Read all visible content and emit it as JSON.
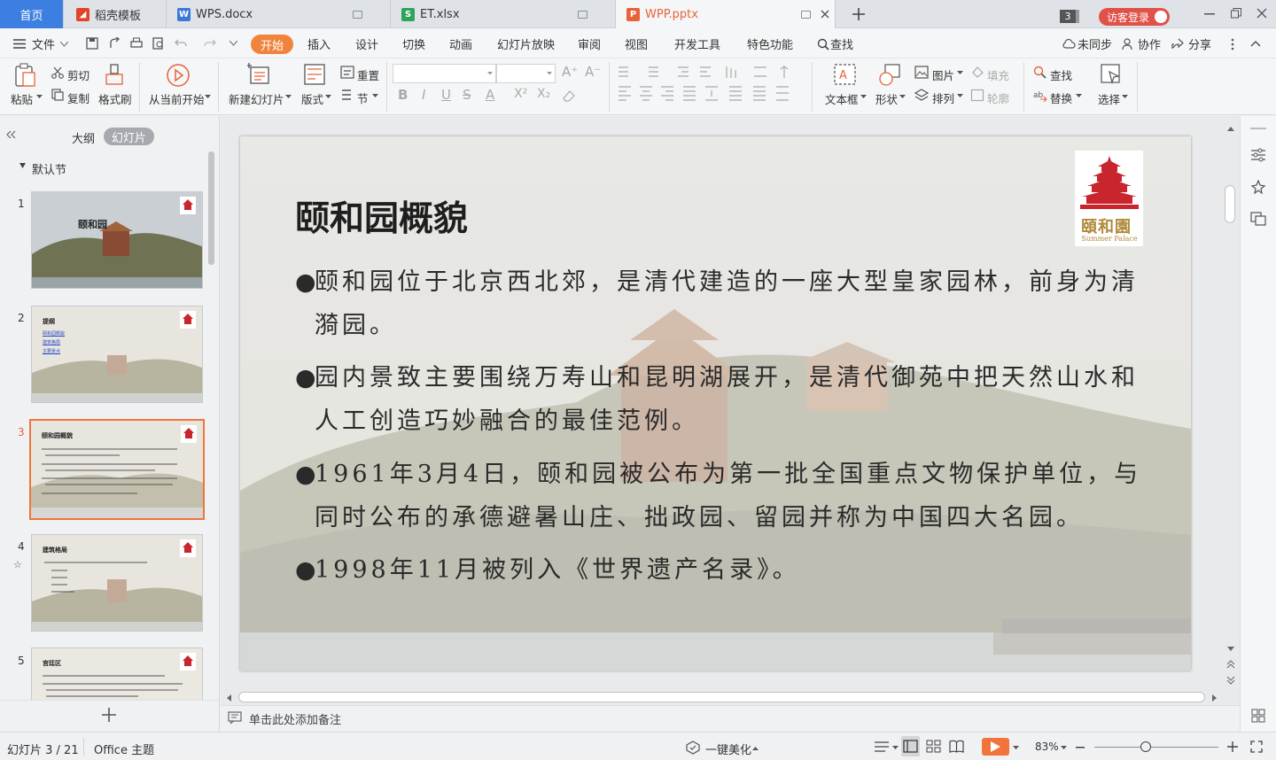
{
  "tabs": {
    "home": "首页",
    "items": [
      {
        "label": "稻壳模板",
        "icon": "daoke-icon",
        "color": "#e0452b"
      },
      {
        "label": "WPS.docx",
        "icon": "word-icon",
        "color": "#3b78d8"
      },
      {
        "label": "ET.xlsx",
        "icon": "excel-icon",
        "color": "#2fa35a"
      },
      {
        "label": "WPP.pptx",
        "icon": "ppt-icon",
        "color": "#e8623a"
      }
    ],
    "count": "3",
    "visitor_login": "访客登录"
  },
  "menu": {
    "file": "文件",
    "tabs": [
      "开始",
      "插入",
      "设计",
      "切换",
      "动画",
      "幻灯片放映",
      "审阅",
      "视图",
      "开发工具",
      "特色功能"
    ],
    "search": "查找",
    "sync": "未同步",
    "collab": "协作",
    "share": "分享"
  },
  "ribbon": {
    "paste": "粘贴",
    "cut": "剪切",
    "copy": "复制",
    "format_painter": "格式刷",
    "play_from_current": "从当前开始",
    "new_slide": "新建幻灯片",
    "layout": "版式",
    "reset": "重置",
    "section": "节",
    "text_box": "文本框",
    "shape": "形状",
    "picture": "图片",
    "fill": "填充",
    "arrange": "排列",
    "outline": "轮廓",
    "find": "查找",
    "replace": "替换",
    "select": "选择"
  },
  "left_panel": {
    "outline_tab": "大纲",
    "slides_tab": "幻灯片",
    "section": "默认节",
    "thumbnails": [
      {
        "num": "1",
        "title": "颐和园"
      },
      {
        "num": "2",
        "title": "提纲",
        "links": [
          "颐和园概貌",
          "建筑格局",
          "主要景点"
        ]
      },
      {
        "num": "3",
        "title": "颐和园概貌"
      },
      {
        "num": "4",
        "title": "建筑格局"
      },
      {
        "num": "5",
        "title": "宫廷区"
      }
    ]
  },
  "slide": {
    "title": "颐和园概貌",
    "logo_text": "頤和園",
    "logo_subtitle": "Summer Palace",
    "bullets": [
      "颐和园位于北京西北郊，是清代建造的一座大型皇家园林，前身为清漪园。",
      "园内景致主要围绕万寿山和昆明湖展开，是清代御苑中把天然山水和人工创造巧妙融合的最佳范例。",
      "1961年3月4日，颐和园被公布为第一批全国重点文物保护单位，与同时公布的承德避暑山庄、拙政园、留园并称为中国四大名园。",
      "1998年11月被列入《世界遗产名录》。"
    ]
  },
  "notes_placeholder": "单击此处添加备注",
  "status": {
    "slide_info": "幻灯片 3 / 21",
    "theme": "Office 主题",
    "beautify": "一键美化",
    "zoom": "83%"
  },
  "colors": {
    "accent": "#f0843c",
    "home_tab": "#3d7fe0",
    "visitor": "#e0514a",
    "logo_red": "#c8252c"
  }
}
